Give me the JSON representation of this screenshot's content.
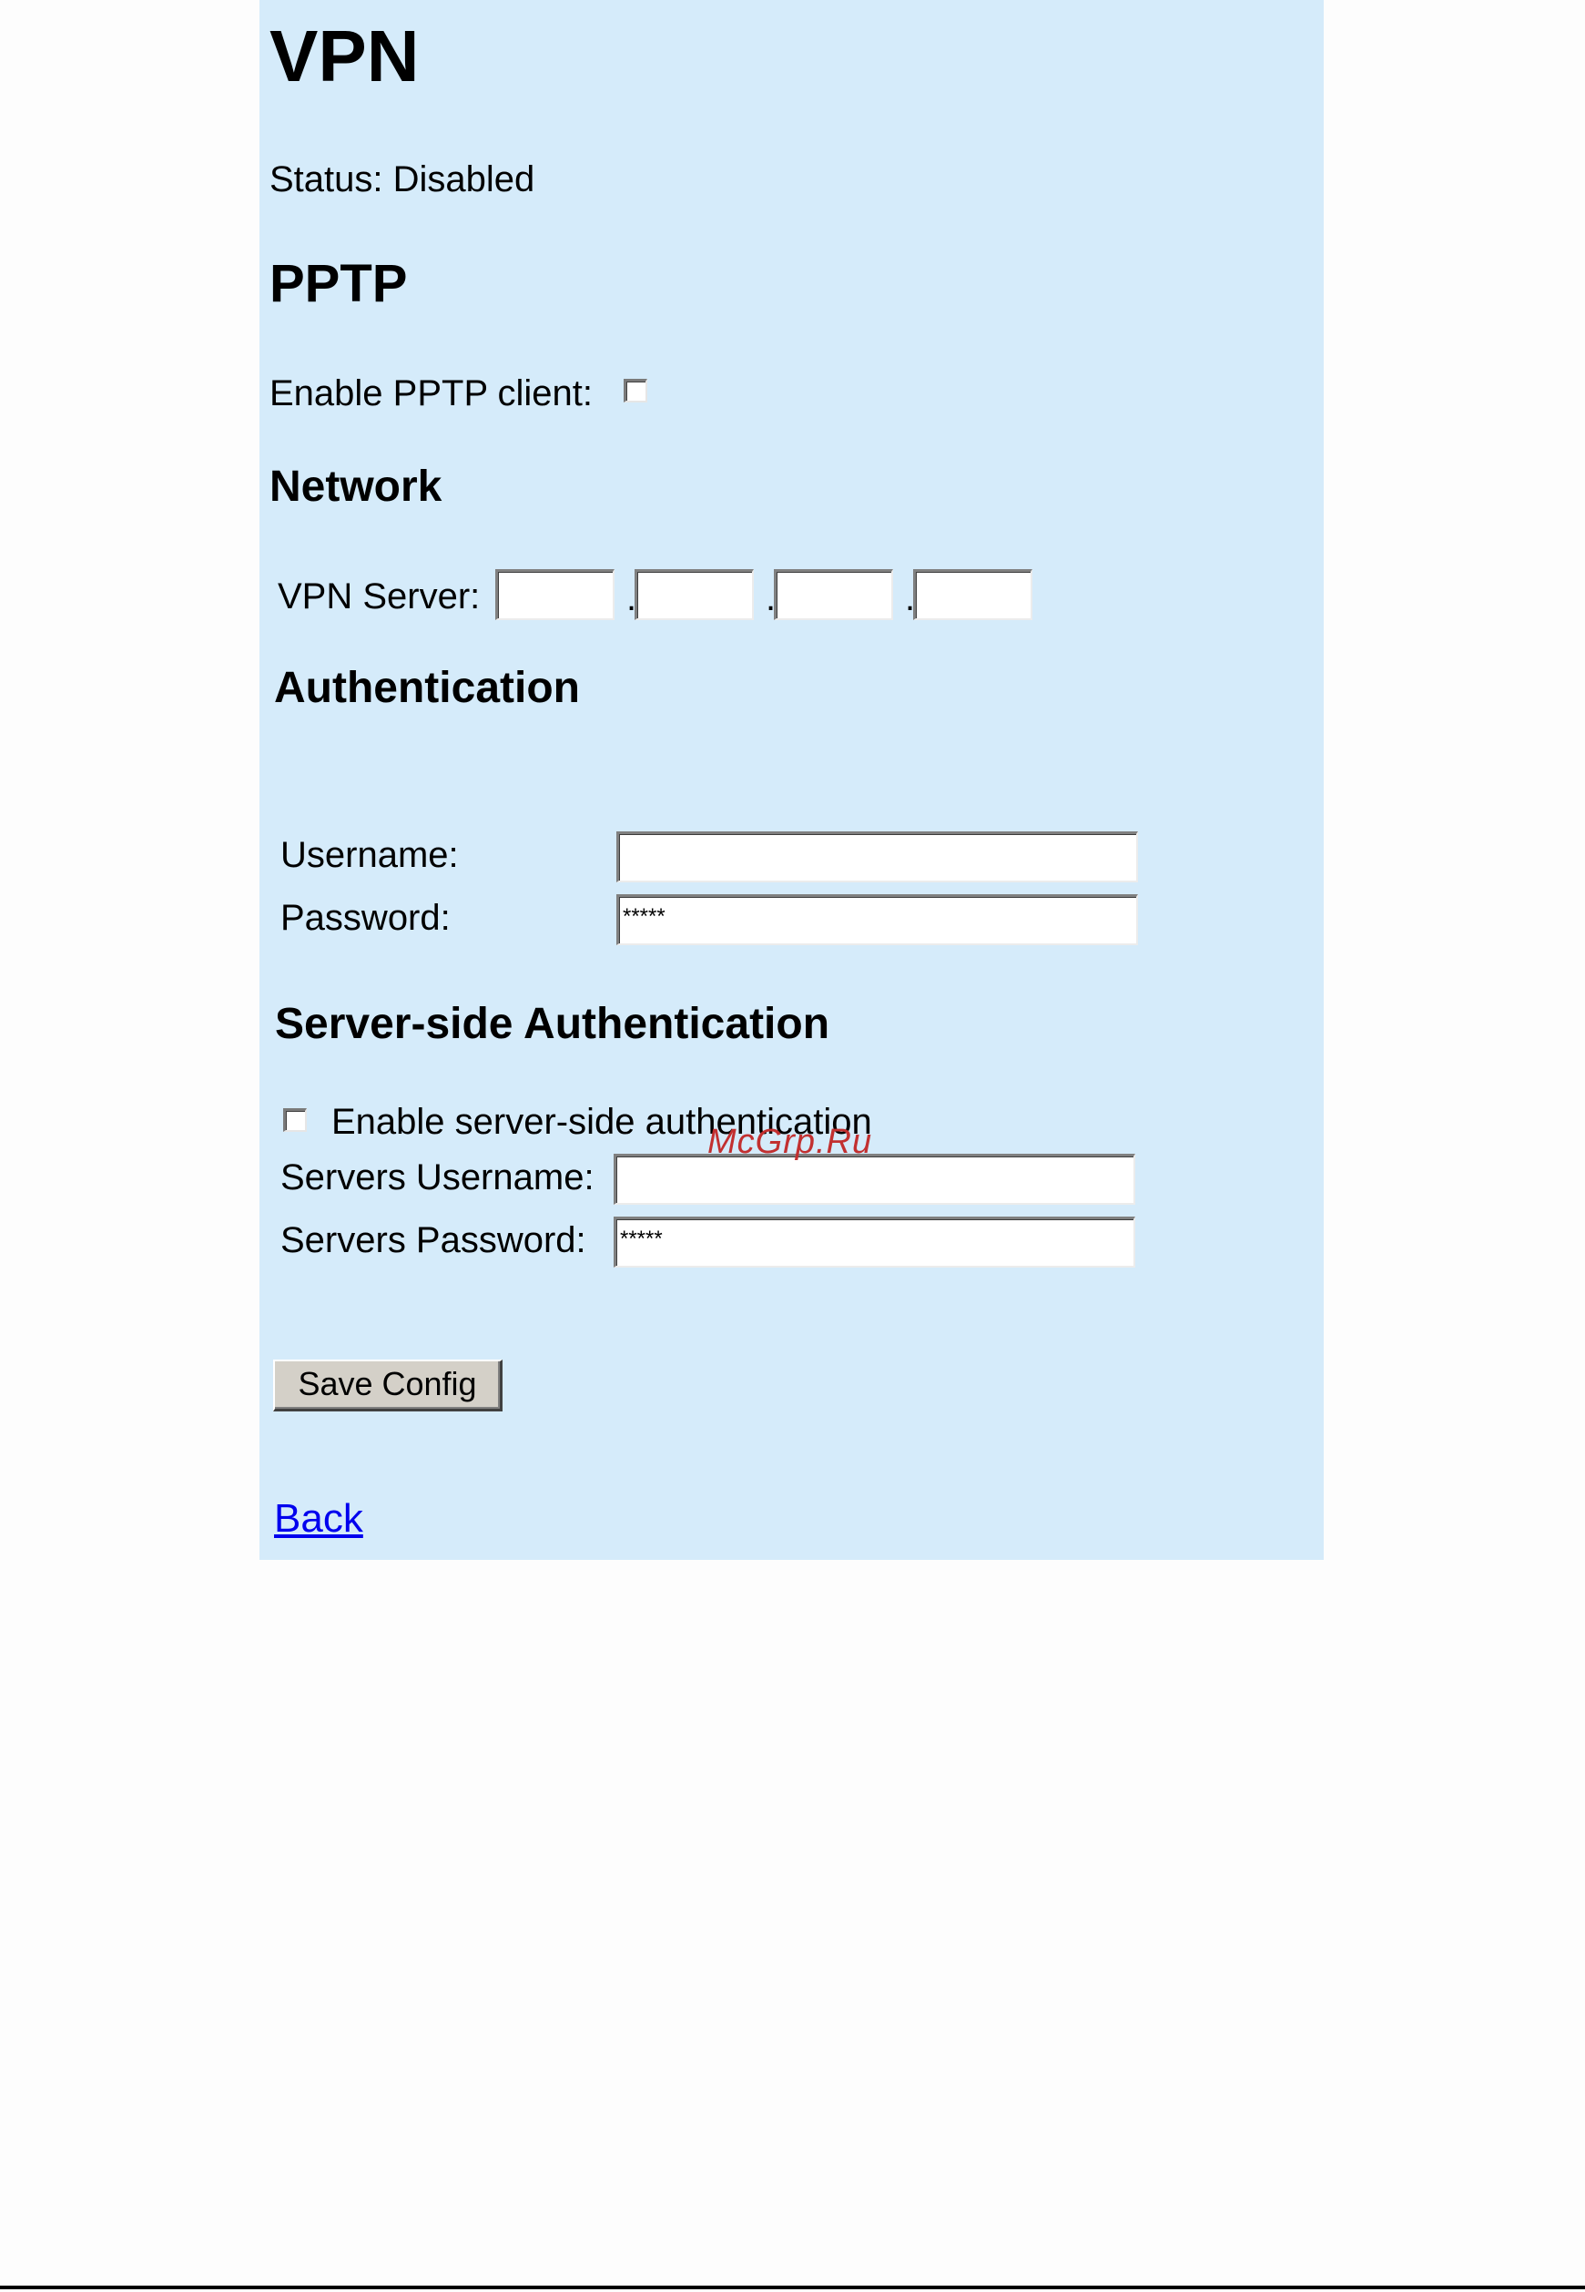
{
  "page": {
    "title": "VPN",
    "status_label": "Status: Disabled"
  },
  "pptp": {
    "heading": "PPTP",
    "enable_label": "Enable PPTP client:",
    "enabled": false
  },
  "network": {
    "heading": "Network",
    "vpn_server_label": "VPN Server:",
    "separator": ".",
    "octets": [
      "",
      "",
      "",
      ""
    ]
  },
  "authentication": {
    "heading": "Authentication",
    "username_label": "Username:",
    "username_value": "",
    "password_label": "Password:",
    "password_value": "*****"
  },
  "server_side_authentication": {
    "heading": "Server-side Authentication",
    "enable_label": "Enable server-side authentication",
    "enabled": false,
    "servers_username_label": "Servers Username:",
    "servers_username_value": "",
    "servers_password_label": "Servers Password:",
    "servers_password_value": "*****"
  },
  "actions": {
    "save_label": "Save Config",
    "back_label": "Back"
  },
  "watermark": {
    "text": "McGrp.Ru"
  }
}
